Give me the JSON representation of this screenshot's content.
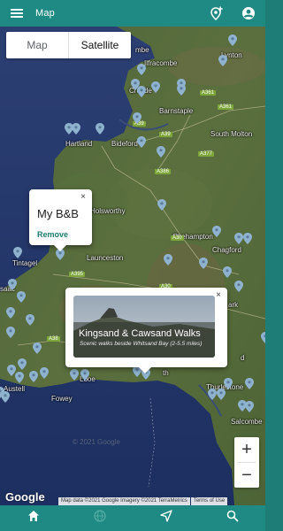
{
  "header": {
    "title": "Map"
  },
  "map_type": {
    "map_label": "Map",
    "satellite_label": "Satellite",
    "selected": "Satellite"
  },
  "places": [
    {
      "name": "Lynton"
    },
    {
      "name": "Ilfracombe"
    },
    {
      "name": "Croyde"
    },
    {
      "name": "Barnstaple"
    },
    {
      "name": "Hartland"
    },
    {
      "name": "Bideford"
    },
    {
      "name": "South Molton"
    },
    {
      "name": "Holsworthy"
    },
    {
      "name": "Okehampton"
    },
    {
      "name": "Chagford"
    },
    {
      "name": "Tintagel"
    },
    {
      "name": "Launceston"
    },
    {
      "name": "saac"
    },
    {
      "name": "Looe"
    },
    {
      "name": "Fowey"
    },
    {
      "name": "Austell"
    },
    {
      "name": "Thurlestone"
    },
    {
      "name": "Salcombe"
    },
    {
      "name": "mbe"
    },
    {
      "name": "ark"
    },
    {
      "name": "th"
    },
    {
      "name": "d"
    }
  ],
  "roads": [
    "A361",
    "A39",
    "A39",
    "A361",
    "A377",
    "A386",
    "A30",
    "A38",
    "A395",
    "A30"
  ],
  "popup_bnb": {
    "name": "My B&B",
    "action": "Remove",
    "close": "×"
  },
  "popup_walk": {
    "title": "Kingsand & Cawsand Walks",
    "subtitle": "Scenic walks beside Whitsand Bay (2-5.5 miles)",
    "close": "×"
  },
  "zoom": {
    "in": "+",
    "out": "−"
  },
  "footer": {
    "google": "Google",
    "map_data": "Map data ©2021 Google Imagery ©2021 TerraMetrics",
    "terms": "Terms of Use",
    "faint_copyright": "© 2021 Google"
  },
  "nav": [
    "home-icon",
    "globe-icon",
    "navigate-icon",
    "search-icon"
  ],
  "colors": {
    "brand": "#1f8a83",
    "link": "#1f7b6f",
    "pin": "#8fb2cf"
  }
}
